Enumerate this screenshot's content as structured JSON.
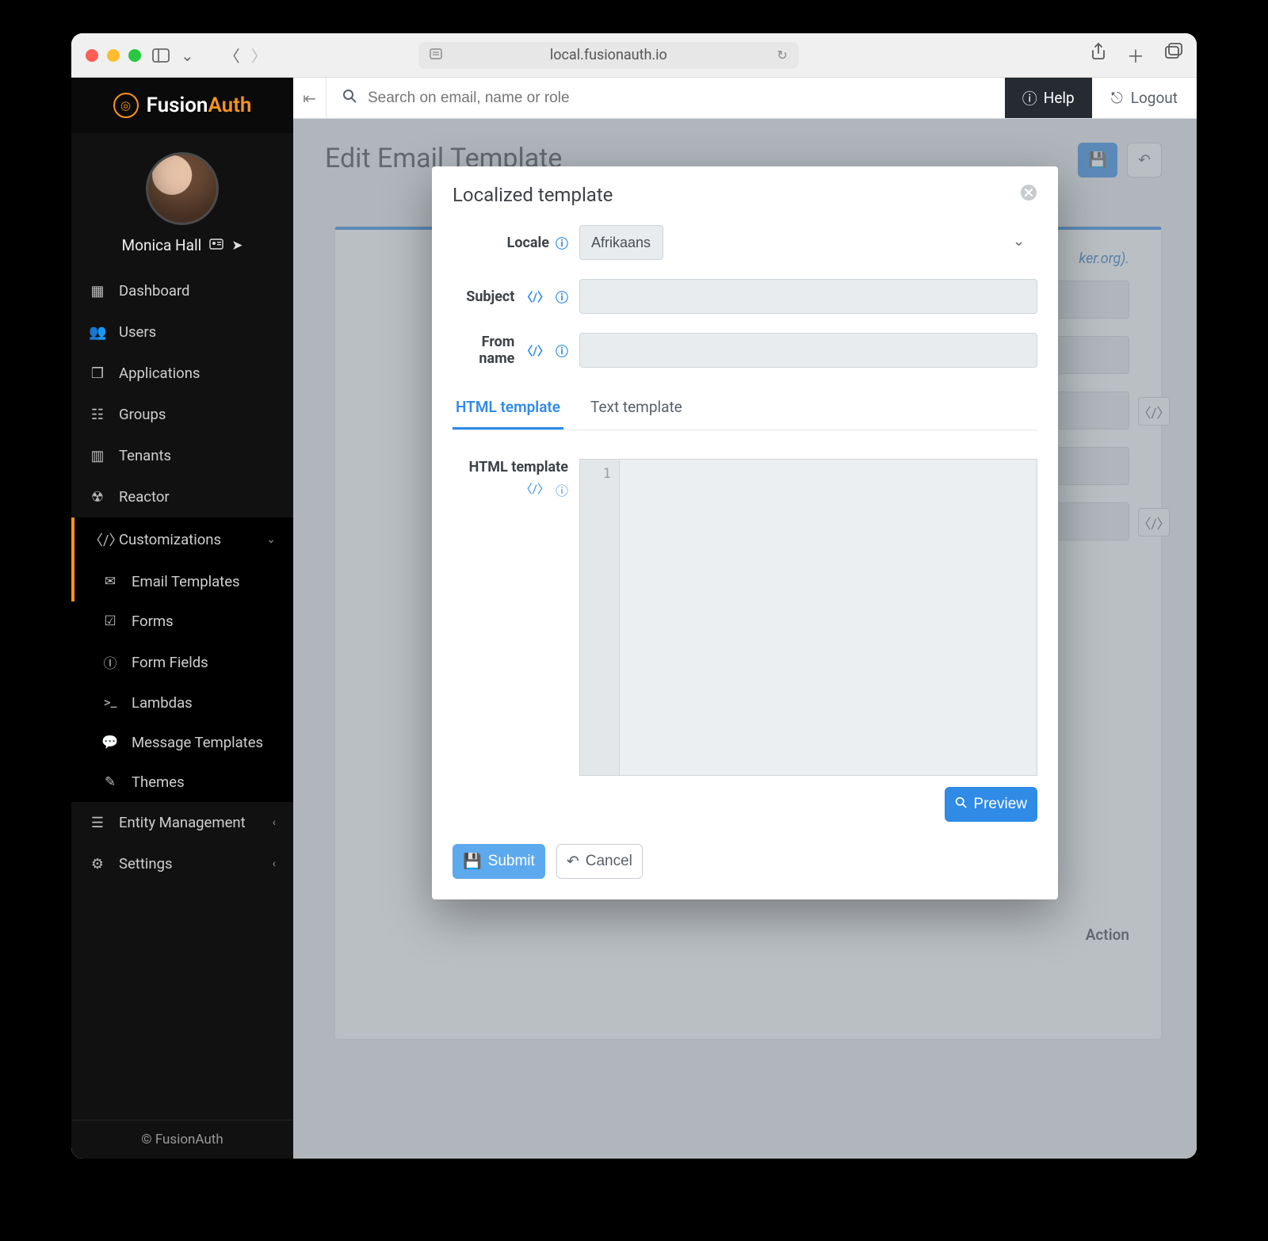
{
  "browser": {
    "url": "local.fusionauth.io"
  },
  "brand": {
    "name_a": "Fusion",
    "name_b": "Auth"
  },
  "profile": {
    "name": "Monica Hall"
  },
  "topbar": {
    "search_placeholder": "Search on email, name or role",
    "help": "Help",
    "logout": "Logout"
  },
  "page": {
    "title": "Edit Email Template",
    "ghost_hint": "ker.org).",
    "ghost_action": "Action"
  },
  "nav": {
    "dashboard": "Dashboard",
    "users": "Users",
    "applications": "Applications",
    "groups": "Groups",
    "tenants": "Tenants",
    "reactor": "Reactor",
    "customizations": "Customizations",
    "email_templates": "Email Templates",
    "forms": "Forms",
    "form_fields": "Form Fields",
    "lambdas": "Lambdas",
    "message_templates": "Message Templates",
    "themes": "Themes",
    "entity_management": "Entity Management",
    "settings": "Settings",
    "copyright": "© FusionAuth"
  },
  "modal": {
    "title": "Localized template",
    "labels": {
      "locale": "Locale",
      "subject": "Subject",
      "from_name": "From name",
      "html_template": "HTML template"
    },
    "locale_value": "Afrikaans",
    "subject_value": "",
    "from_name_value": "",
    "tabs": {
      "html": "HTML template",
      "text": "Text template"
    },
    "editor": {
      "line1": "1",
      "content": ""
    },
    "buttons": {
      "preview": "Preview",
      "submit": "Submit",
      "cancel": "Cancel"
    }
  }
}
